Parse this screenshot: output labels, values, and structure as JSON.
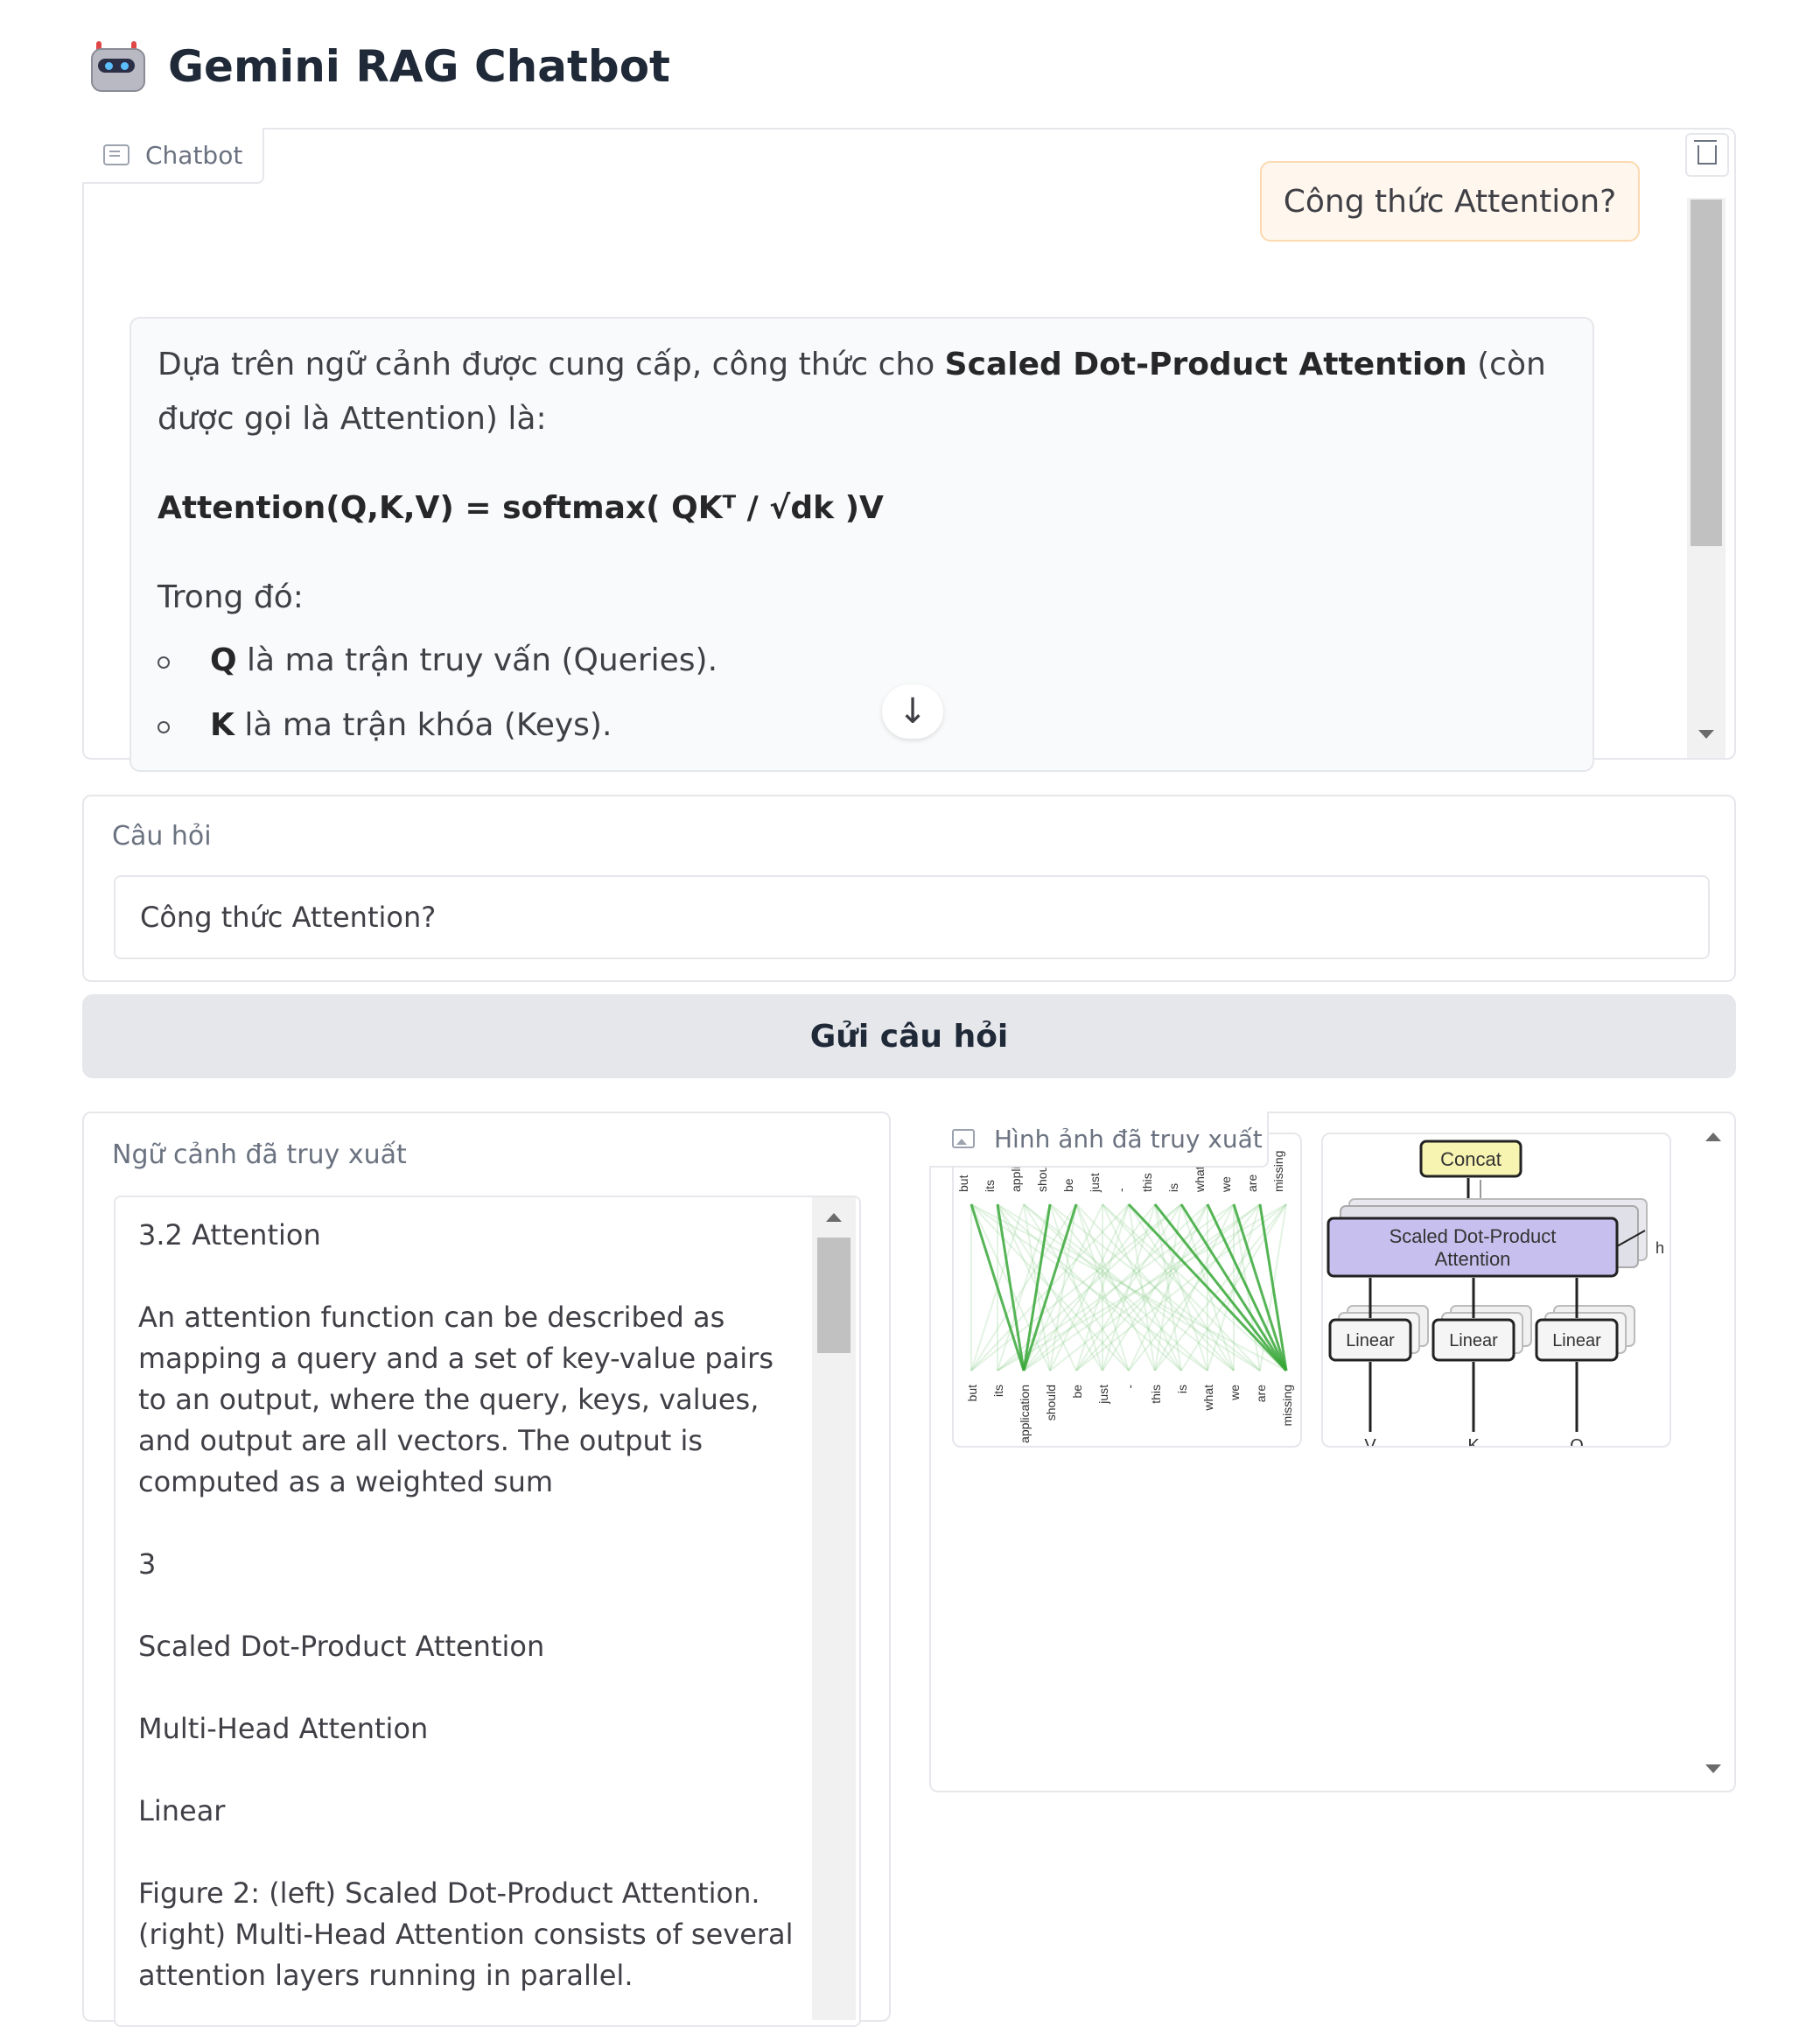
{
  "app": {
    "title": "Gemini RAG Chatbot"
  },
  "chatbot": {
    "tab_label": "Chatbot",
    "user_message": "Công thức Attention?",
    "bot_reply": {
      "intro_pre": "Dựa trên ngữ cảnh được cung cấp, công thức cho ",
      "intro_bold": "Scaled Dot-Product Attention",
      "intro_post": " (còn được gọi là Attention) là:",
      "formula": "Attention(Q,K,V) = softmax( QKᵀ / √dk )V",
      "where": "Trong đó:",
      "bullets": [
        {
          "term": "Q",
          "text": " là ma trận truy vấn (Queries)."
        },
        {
          "term": "K",
          "text": " là ma trận khóa (Keys)."
        }
      ]
    },
    "scroll_down_icon": "↓"
  },
  "question": {
    "label": "Câu hỏi",
    "value": "Công thức Attention?"
  },
  "send_button": {
    "label": "Gửi câu hỏi"
  },
  "context": {
    "label": "Ngữ cảnh đã truy xuất",
    "text": "3.2 Attention\n\nAn attention function can be described as mapping a query and a set of key-value pairs to an output, where the query, keys, values, and output are all vectors. The output is computed as a weighted sum\n\n3\n\nScaled Dot-Product Attention\n\nMulti-Head Attention\n\nLinear\n\nFigure 2: (left) Scaled Dot-Product Attention. (right) Multi-Head Attention consists of several attention layers running in parallel."
  },
  "gallery": {
    "label": "Hình ảnh đã truy xuất",
    "image1": {
      "top_words": [
        "but",
        "its",
        "application",
        "should",
        "be",
        "just",
        "-",
        "this",
        "is",
        "what",
        "we",
        "are",
        "missing"
      ],
      "bottom_words": [
        "but",
        "its",
        "application",
        "should",
        "be",
        "just",
        "-",
        "this",
        "is",
        "what",
        "we",
        "are",
        "missing"
      ]
    },
    "image2": {
      "concat": "Concat",
      "sdpa_line1": "Scaled Dot-Product",
      "sdpa_line2": "Attention",
      "linear": "Linear",
      "h": "h",
      "inputs": [
        "V",
        "K",
        "Q"
      ]
    }
  },
  "colors": {
    "user_bubble_bg": "#fff7ed",
    "accent_green": "#3aa83a",
    "sdpa_fill": "#c7c0ee",
    "concat_fill": "#f7f3b0"
  }
}
